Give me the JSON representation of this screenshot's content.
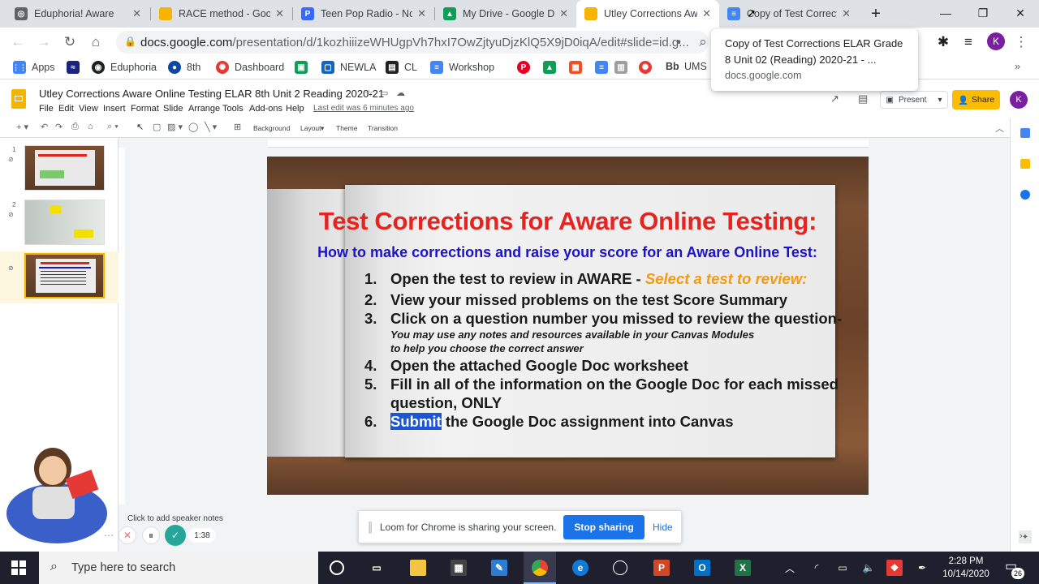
{
  "tabs": [
    {
      "title": "Eduphoria! Aware",
      "icon": "chrome-icon",
      "color": "#5f6368"
    },
    {
      "title": "RACE method - Goo",
      "icon": "slides-icon",
      "color": "#f4b400"
    },
    {
      "title": "Teen Pop Radio - No",
      "icon": "pandora-icon",
      "color": "#3668ff"
    },
    {
      "title": "My Drive - Google D",
      "icon": "drive-icon",
      "color": "#0f9d58"
    },
    {
      "title": "Utley Corrections Aw",
      "icon": "slides-icon",
      "color": "#f4b400"
    },
    {
      "title": "Copy of Test Correct",
      "icon": "docs-icon",
      "color": "#4285f4"
    }
  ],
  "address": {
    "host": "docs.google.com",
    "path": "/presentation/d/1kozhiiizeWHUgpVh7hxI7OwZjtyuDjzKlQ5X9jD0iqA/edit#slide=id.g..."
  },
  "bookmarks": [
    "Apps",
    "",
    "Eduphoria",
    "8th",
    "Dashboard",
    "",
    "NEWLA",
    "CL",
    "Workshop",
    "",
    "",
    "",
    "",
    "",
    "",
    "Bb",
    "UMS"
  ],
  "tooltip": {
    "title": "Copy of Test Corrections ELAR Grade 8 Unit 02 (Reading) 2020-21 - ...",
    "url": "docs.google.com"
  },
  "slides": {
    "doc_title": "Utley Corrections Aware Online Testing ELAR 8th Unit 2 Reading 2020-21",
    "menus": [
      "File",
      "Edit",
      "View",
      "Insert",
      "Format",
      "Slide",
      "Arrange",
      "Tools",
      "Add-ons",
      "Help"
    ],
    "last_edit": "Last edit was 6 minutes ago",
    "present": "Present",
    "share": "Share",
    "avatar": "K",
    "toolbar": {
      "background": "Background",
      "layout": "Layout",
      "theme": "Theme",
      "transition": "Transition"
    },
    "thumb_numbers": [
      "1",
      "2",
      "3"
    ],
    "notes": "Click to add speaker notes"
  },
  "slide": {
    "title": "Test Corrections for Aware Online Testing:",
    "subtitle": "How to make corrections and raise your score for an Aware Online Test:",
    "items": [
      {
        "n": "1.",
        "text": "Open the test to review in AWARE - ",
        "extra": "Select a test to review:"
      },
      {
        "n": "2.",
        "text": "View your missed problems on the test Score Summary"
      },
      {
        "n": "3.",
        "text": "Click on a question number you missed to review the question-"
      },
      {
        "n": "4.",
        "text": "Open the attached Google Doc worksheet"
      },
      {
        "n": "5.",
        "text": "Fill in all of the information on the Google Doc for each missed",
        "line2": "question, ONLY"
      },
      {
        "n": "6.",
        "highlight": "Submit",
        "text": " the Google Doc assignment into Canvas"
      }
    ],
    "note1": "You may use any notes and resources available in your Canvas Modules",
    "note2": "to help you choose the correct answer"
  },
  "loom": {
    "message": "Loom for Chrome is sharing your screen.",
    "stop": "Stop sharing",
    "hide": "Hide",
    "timer": "1:38"
  },
  "taskbar": {
    "search_placeholder": "Type here to search",
    "time": "2:28 PM",
    "date": "10/14/2020",
    "notifications": "26"
  }
}
